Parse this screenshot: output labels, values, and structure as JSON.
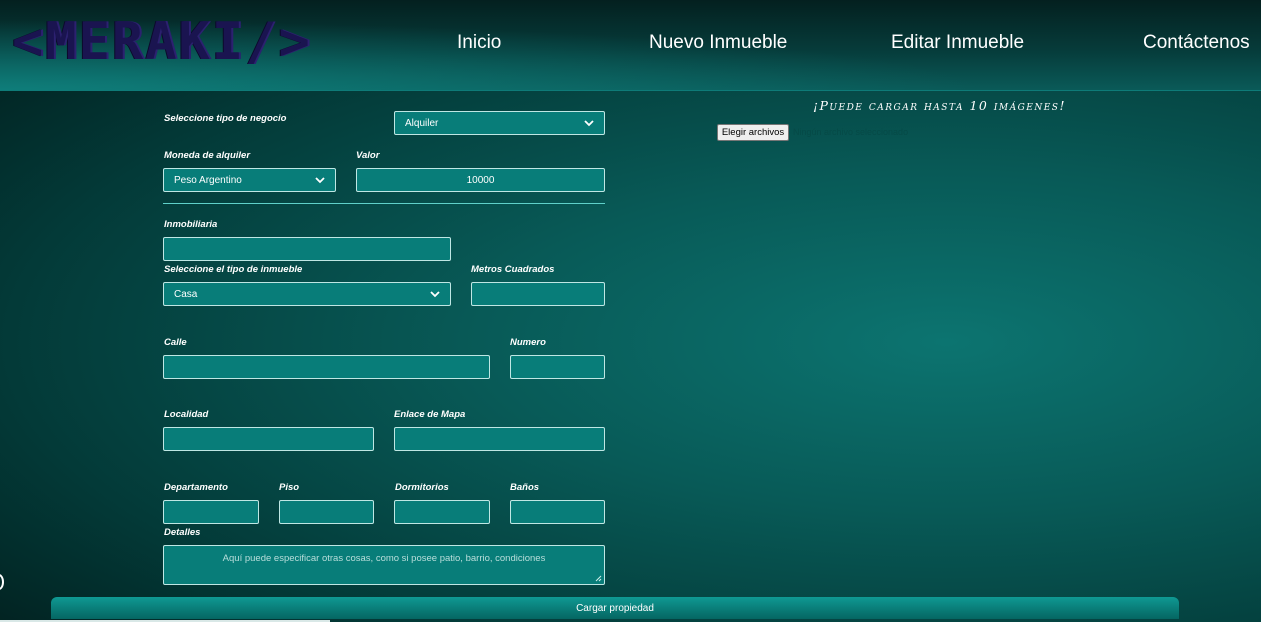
{
  "brand": {
    "logo_text": "<MERAKI/>"
  },
  "nav": {
    "items": [
      {
        "label": "Inicio"
      },
      {
        "label": "Nuevo Inmueble"
      },
      {
        "label": "Editar Inmueble"
      },
      {
        "label": "Contáctenos"
      }
    ]
  },
  "form": {
    "tipo_negocio": {
      "label": "Seleccione tipo de negocio",
      "value": "Alquiler"
    },
    "moneda": {
      "label": "Moneda de alquiler",
      "value": "Peso Argentino"
    },
    "valor": {
      "label": "Valor",
      "value": "10000"
    },
    "inmobiliaria": {
      "label": "Inmobiliaria",
      "value": ""
    },
    "tipo_inmueble": {
      "label": "Seleccione el tipo de inmueble",
      "value": "Casa"
    },
    "metros": {
      "label": "Metros Cuadrados",
      "value": ""
    },
    "calle": {
      "label": "Calle",
      "value": ""
    },
    "numero": {
      "label": "Numero",
      "value": ""
    },
    "localidad": {
      "label": "Localidad",
      "value": ""
    },
    "enlace_mapa": {
      "label": "Enlace de Mapa",
      "value": ""
    },
    "departamento": {
      "label": "Departamento",
      "value": ""
    },
    "piso": {
      "label": "Piso",
      "value": ""
    },
    "dormitorios": {
      "label": "Dormitorios",
      "value": ""
    },
    "banos": {
      "label": "Baños",
      "value": ""
    },
    "detalles": {
      "label": "Detalles",
      "placeholder": "Aquí puede especificar otras cosas, como si posee patio, barrio, condiciones"
    },
    "submit_label": "Cargar propiedad"
  },
  "images": {
    "note": "¡Puede cargar hasta 10 imágenes!",
    "button_label": "Elegir archivos",
    "status": "Ningún archivo seleccionado"
  },
  "colors": {
    "accent": "#087d79",
    "field_border": "#bfe7e4",
    "header_bg": "#063b3a"
  },
  "icons": [
    "chevron-down-icon",
    "resize-handle-icon"
  ]
}
